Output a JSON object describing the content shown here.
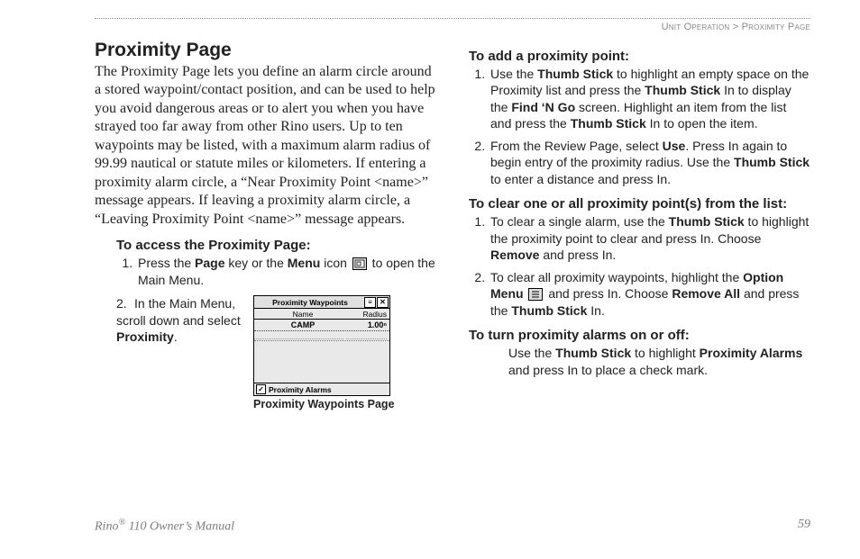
{
  "breadcrumb": {
    "section": "Unit Operation",
    "sep": " > ",
    "page": "Proximity Page"
  },
  "title": "Proximity Page",
  "intro": "The Proximity Page lets you define an alarm circle around a stored waypoint/contact position, and can be used to help you avoid dangerous areas or to alert you when you have strayed too far away from other Rino users. Up to ten waypoints may be listed, with a maximum alarm radius of 99.99 nautical or statute miles or kilometers. If entering a proximity alarm circle, a “Near Proximity Point <name>” message appears. If leaving a proximity alarm circle, a “Leaving Proximity Point <name>” message appears.",
  "access": {
    "heading": "To access the Proximity Page:",
    "step1": {
      "pre": "Press the ",
      "b1": "Page",
      "mid": " key or the ",
      "b2": "Menu",
      "post1": " icon ",
      "post2": " to open the Main Menu."
    },
    "step2": {
      "pre": "In the Main Menu, scroll down and select ",
      "b1": "Proximity",
      "post": "."
    }
  },
  "figure": {
    "caption": "Proximity Waypoints Page",
    "screen": {
      "title": "Proximity Waypoints",
      "menu_btn": "≡",
      "close_btn": "✕",
      "col1": "Name",
      "col2": "Radius",
      "row_name": "CAMP",
      "row_radius": "1.00ⁿ",
      "checkbox_mark": "✓",
      "checkbox_label": "Proximity Alarms"
    }
  },
  "add": {
    "heading": "To add a proximity point:",
    "step1": {
      "t1": "Use the ",
      "b1": "Thumb Stick",
      "t2": " to highlight an empty space on the Proximity list and press the ",
      "b2": "Thumb Stick",
      "t3": " In to display the ",
      "b3": "Find ‘N Go",
      "t4": " screen. Highlight an item from the list and press the ",
      "b4": "Thumb Stick",
      "t5": " In to open the item."
    },
    "step2": {
      "t1": "From the Review Page, select ",
      "b1": "Use",
      "t2": ". Press In again to begin entry of the proximity radius. Use the ",
      "b2": "Thumb Stick",
      "t3": " to enter a distance and press In."
    }
  },
  "clear": {
    "heading": "To clear one or all proximity point(s) from the list:",
    "step1": {
      "t1": "To clear a single alarm, use the ",
      "b1": "Thumb Stick",
      "t2": " to highlight the proximity point to clear and press In. Choose ",
      "b2": "Remove",
      "t3": " and press In."
    },
    "step2": {
      "t1": "To clear all proximity waypoints, highlight the ",
      "b1": "Option Menu",
      "t2": " ",
      "t3": " and press In. Choose ",
      "b2": "Remove All",
      "t4": " and press the ",
      "b3": "Thumb Stick",
      "t5": " In."
    }
  },
  "onoff": {
    "heading": "To turn proximity alarms on or off:",
    "body": {
      "t1": "Use the ",
      "b1": "Thumb Stick",
      "t2": " to highlight ",
      "b2": "Proximity Alarms",
      "t3": " and press In to place a check mark."
    }
  },
  "footer": {
    "left_pre": "Rino",
    "left_reg": "®",
    "left_post": " 110 Owner’s Manual",
    "page_no": "59"
  }
}
